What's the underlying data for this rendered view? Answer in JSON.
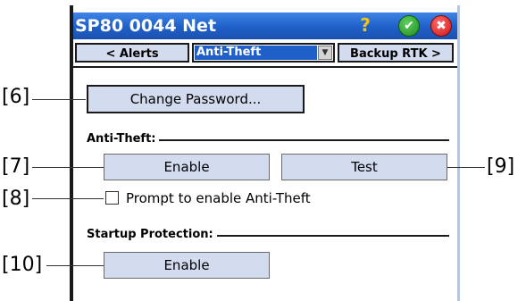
{
  "window": {
    "title": "SP80 0044 Net",
    "help_icon": "?",
    "ok_icon": "✔",
    "close_icon": "✖"
  },
  "nav": {
    "prev_label": "< Alerts",
    "current_page": "Anti-Theft",
    "next_label": "Backup RTK >",
    "dropdown_arrow": "▼"
  },
  "content": {
    "change_password_label": "Change Password...",
    "anti_theft_heading": "Anti-Theft:",
    "enable_label": "Enable",
    "test_label": "Test",
    "prompt_checkbox_label": "Prompt to enable Anti-Theft",
    "prompt_checked": false,
    "startup_heading": "Startup Protection:",
    "startup_enable_label": "Enable"
  },
  "callouts": {
    "c6": "[6]",
    "c7": "[7]",
    "c8": "[8]",
    "c9": "[9]",
    "c10": "[10]"
  }
}
